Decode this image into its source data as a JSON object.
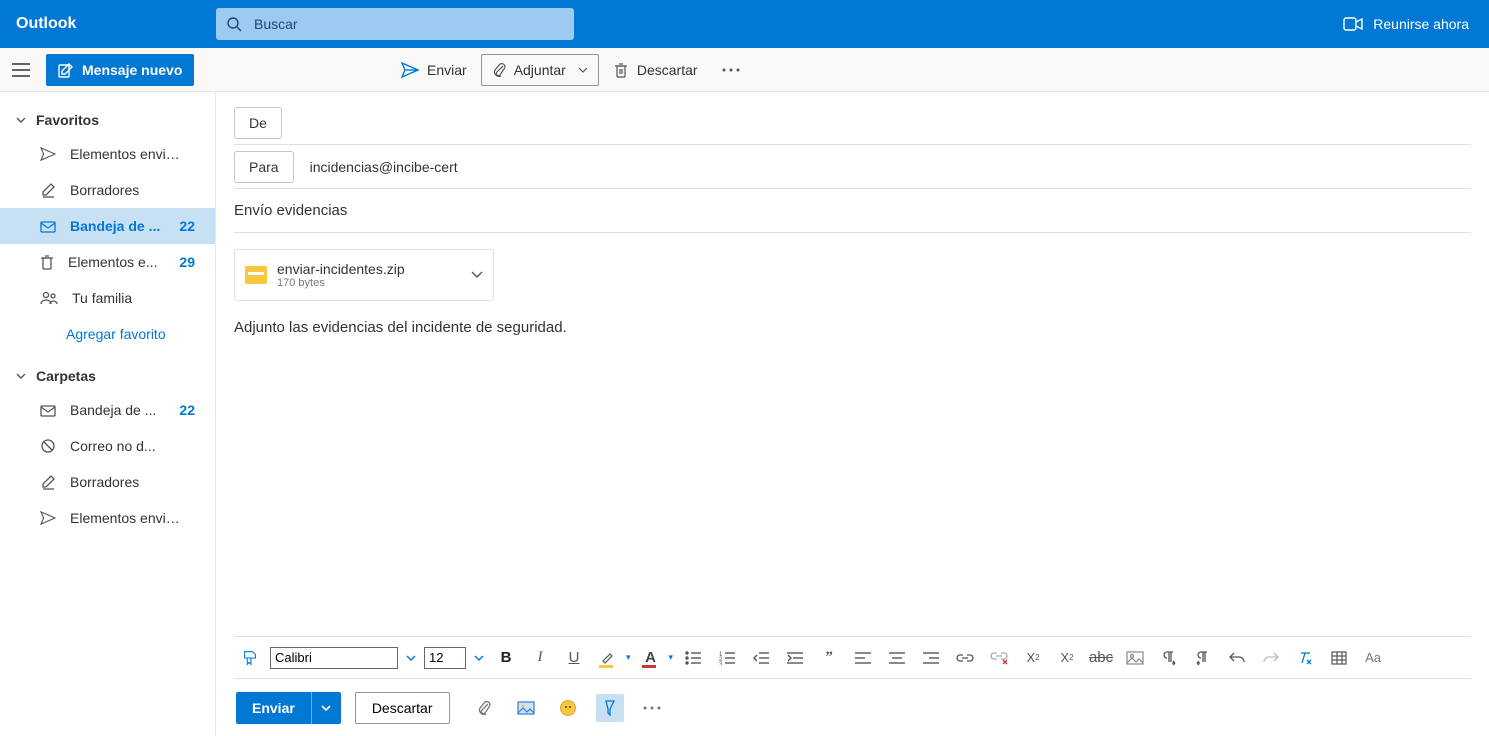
{
  "header": {
    "brand": "Outlook",
    "search_placeholder": "Buscar",
    "meet_now": "Reunirse ahora"
  },
  "cmd": {
    "new_message": "Mensaje nuevo",
    "send": "Enviar",
    "attach": "Adjuntar",
    "discard": "Descartar"
  },
  "sidebar": {
    "favorites_header": "Favoritos",
    "folders_header": "Carpetas",
    "add_favorite": "Agregar favorito",
    "fav_items": [
      {
        "label": "Elementos envia...",
        "icon": "sent",
        "count": ""
      },
      {
        "label": "Borradores",
        "icon": "drafts",
        "count": ""
      },
      {
        "label": "Bandeja de ...",
        "icon": "inbox",
        "count": "22",
        "active": true
      },
      {
        "label": "Elementos e...",
        "icon": "trash",
        "count": "29"
      },
      {
        "label": "Tu familia",
        "icon": "group",
        "count": ""
      }
    ],
    "folders": [
      {
        "label": "Bandeja de ...",
        "icon": "inbox",
        "count": "22"
      },
      {
        "label": "Correo no d...",
        "icon": "junk",
        "count": ""
      },
      {
        "label": "Borradores",
        "icon": "drafts",
        "count": ""
      },
      {
        "label": "Elementos envia...",
        "icon": "sent",
        "count": ""
      }
    ]
  },
  "compose": {
    "from_label": "De",
    "to_label": "Para",
    "to_value": "incidencias@incibe-cert",
    "subject": "Envío evidencias",
    "attachment": {
      "name": "enviar-incidentes.zip",
      "size": "170 bytes"
    },
    "body": "Adjunto las evidencias del incidente de seguridad."
  },
  "format": {
    "font_name": "Calibri",
    "font_size": "12"
  },
  "bottom": {
    "send": "Enviar",
    "discard": "Descartar"
  }
}
